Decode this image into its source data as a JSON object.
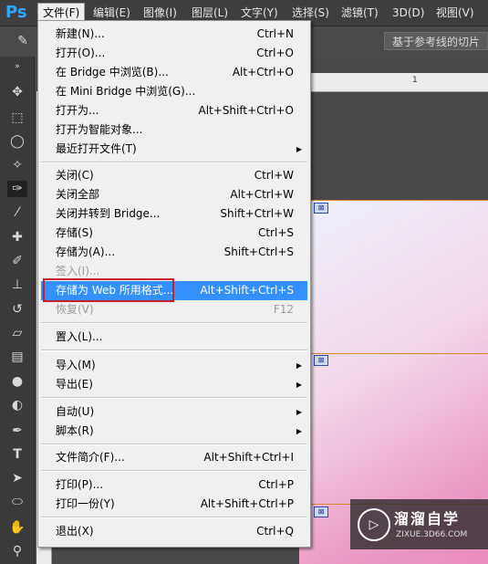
{
  "app": {
    "logo": "Ps"
  },
  "menubar": [
    {
      "label": "文件(F)",
      "active": true
    },
    {
      "label": "编辑(E)"
    },
    {
      "label": "图像(I)"
    },
    {
      "label": "图层(L)"
    },
    {
      "label": "文字(Y)"
    },
    {
      "label": "选择(S)"
    },
    {
      "label": "滤镜(T)"
    },
    {
      "label": "3D(D)"
    },
    {
      "label": "视图(V)"
    }
  ],
  "options_bar": {
    "guides_button": "基于参考线的切片"
  },
  "ruler": {
    "tick_1": "1"
  },
  "file_menu": [
    {
      "label": "新建(N)...",
      "shortcut": "Ctrl+N"
    },
    {
      "label": "打开(O)...",
      "shortcut": "Ctrl+O"
    },
    {
      "label": "在 Bridge 中浏览(B)...",
      "shortcut": "Alt+Ctrl+O"
    },
    {
      "label": "在 Mini Bridge 中浏览(G)...",
      "shortcut": ""
    },
    {
      "label": "打开为...",
      "shortcut": "Alt+Shift+Ctrl+O"
    },
    {
      "label": "打开为智能对象...",
      "shortcut": ""
    },
    {
      "label": "最近打开文件(T)",
      "shortcut": "",
      "submenu": true
    },
    {
      "label": "关闭(C)",
      "shortcut": "Ctrl+W"
    },
    {
      "label": "关闭全部",
      "shortcut": "Alt+Ctrl+W"
    },
    {
      "label": "关闭并转到 Bridge...",
      "shortcut": "Shift+Ctrl+W"
    },
    {
      "label": "存储(S)",
      "shortcut": "Ctrl+S"
    },
    {
      "label": "存储为(A)...",
      "shortcut": "Shift+Ctrl+S"
    },
    {
      "label": "签入(I)...",
      "shortcut": "",
      "disabled": true
    },
    {
      "label": "存储为 Web 所用格式...",
      "shortcut": "Alt+Shift+Ctrl+S",
      "highlighted": true
    },
    {
      "label": "恢复(V)",
      "shortcut": "F12",
      "disabled": true
    },
    {
      "label": "置入(L)...",
      "shortcut": ""
    },
    {
      "label": "导入(M)",
      "shortcut": "",
      "submenu": true
    },
    {
      "label": "导出(E)",
      "shortcut": "",
      "submenu": true
    },
    {
      "label": "自动(U)",
      "shortcut": "",
      "submenu": true
    },
    {
      "label": "脚本(R)",
      "shortcut": "",
      "submenu": true
    },
    {
      "label": "文件简介(F)...",
      "shortcut": "Alt+Shift+Ctrl+I"
    },
    {
      "label": "打印(P)...",
      "shortcut": "Ctrl+P"
    },
    {
      "label": "打印一份(Y)",
      "shortcut": "Alt+Shift+Ctrl+P"
    },
    {
      "label": "退出(X)",
      "shortcut": "Ctrl+Q"
    }
  ],
  "watermark": {
    "title": "溜溜自学",
    "url": "ZIXUE.3D66.COM"
  },
  "colors": {
    "menu_highlight": "#3390ff",
    "callout_border": "#c8202a",
    "ps_blue": "#30a8ff"
  }
}
